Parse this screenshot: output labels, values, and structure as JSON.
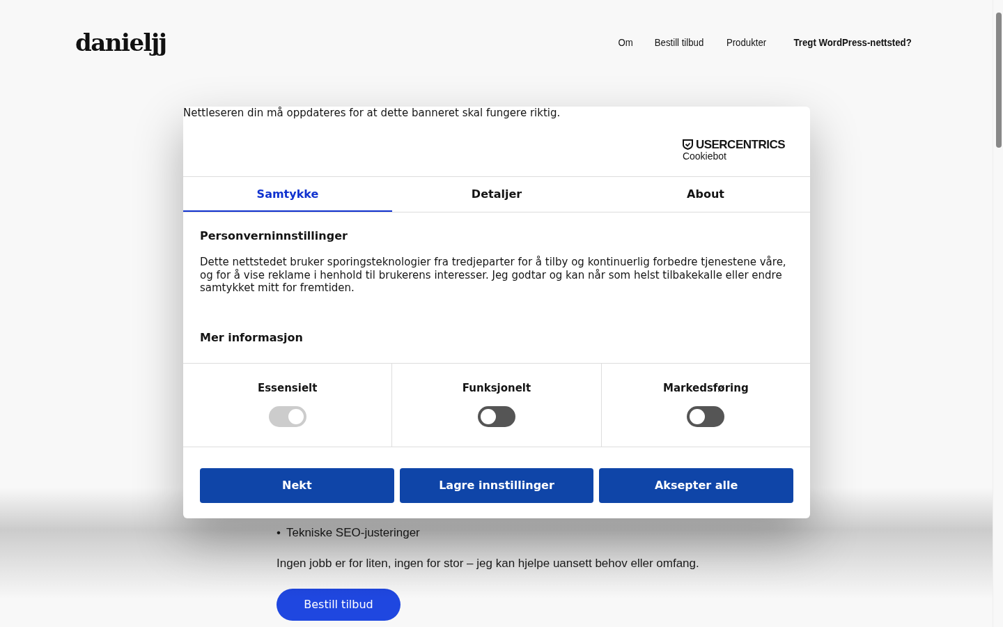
{
  "header": {
    "logo": "danieljj",
    "nav": [
      {
        "label": "Om",
        "bold": false
      },
      {
        "label": "Bestill tilbud",
        "bold": false
      },
      {
        "label": "Produkter",
        "bold": false
      },
      {
        "label": "Tregt WordPress-nettsted?",
        "bold": true
      }
    ]
  },
  "content": {
    "bullets": [
      {
        "marker": "•",
        "text": "Tekniske SEO-justeringer"
      }
    ],
    "paragraph": "Ingen jobb er for liten, ingen for stor – jeg kan hjelpe uansett behov eller omfang.",
    "cta": "Bestill tilbud"
  },
  "dialog": {
    "notice": "Nettleseren din må oppdateres for at dette banneret skal fungere riktig.",
    "brand": {
      "name": "USERCENTRICS",
      "product": "Cookiebot"
    },
    "tabs": [
      {
        "label": "Samtykke",
        "selected": true
      },
      {
        "label": "Detaljer",
        "selected": false
      },
      {
        "label": "About",
        "selected": false
      }
    ],
    "heading": "Personverninnstillinger",
    "body": "Dette nettstedet bruker sporingsteknologier fra tredjeparter for å tilby og kontinuerlig forbedre tjenestene våre, og for å vise reklame i henhold til brukerens interesser. Jeg godtar og kan når som helst tilbakekalle eller endre samtykket mitt for fremtiden.",
    "more_info": "Mer informasjon",
    "categories": [
      {
        "label": "Essensielt",
        "checked": true,
        "disabled": true
      },
      {
        "label": "Funksjonelt",
        "checked": false,
        "disabled": false
      },
      {
        "label": "Markedsføring",
        "checked": false,
        "disabled": false
      }
    ],
    "buttons": [
      "Nekt",
      "Lagre innstillinger",
      "Aksepter alle"
    ]
  }
}
